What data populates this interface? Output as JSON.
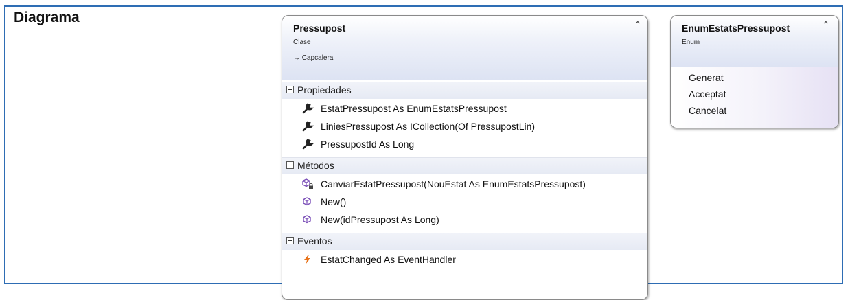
{
  "section_title": "Diagrama",
  "class_shape": {
    "name": "Pressupost",
    "kind": "Clase",
    "inherits": "Capcalera",
    "compartments": [
      {
        "title": "Propiedades",
        "members": [
          {
            "icon": "property-wrench-icon",
            "text": "EstatPressupost As EnumEstatsPressupost"
          },
          {
            "icon": "property-wrench-icon",
            "text": "LiniesPressupost As ICollection(Of PressupostLin)"
          },
          {
            "icon": "property-wrench-icon",
            "text": "PressupostId As Long"
          }
        ]
      },
      {
        "title": "Métodos",
        "members": [
          {
            "icon": "private-method-cube-icon",
            "text": "CanviarEstatPressupost(NouEstat As EnumEstatsPressupost)"
          },
          {
            "icon": "method-cube-icon",
            "text": "New()"
          },
          {
            "icon": "method-cube-icon",
            "text": "New(idPressupost As Long)"
          }
        ]
      },
      {
        "title": "Eventos",
        "members": [
          {
            "icon": "event-lightning-icon",
            "text": "EstatChanged As EventHandler"
          }
        ]
      }
    ]
  },
  "enum_shape": {
    "name": "EnumEstatsPressupost",
    "kind": "Enum",
    "values": [
      "Generat",
      "Acceptat",
      "Cancelat"
    ]
  },
  "colors": {
    "frame_border": "#2e6db4",
    "header_gradient_end": "#dde3f3",
    "method_icon": "#7b4fb8",
    "event_icon": "#e8731a"
  }
}
